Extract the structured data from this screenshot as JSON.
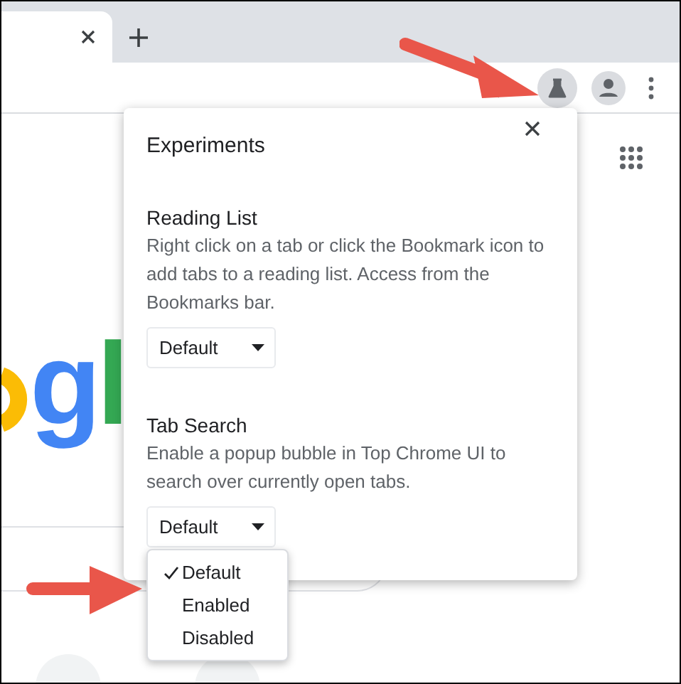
{
  "tab_strip": {
    "tabs": [
      {
        "selected": true
      }
    ]
  },
  "page": {
    "logo_letters": [
      {
        "char": "g",
        "color": "#4285f4"
      },
      {
        "char": "l",
        "color": "#34a853"
      }
    ]
  },
  "experiments": {
    "title": "Experiments",
    "items": [
      {
        "title": "Reading List",
        "description": "Right click on a tab or click the Bookmark icon to add tabs to a reading list. Access from the Bookmarks bar.",
        "select": {
          "value": "Default"
        }
      },
      {
        "title": "Tab Search",
        "description": "Enable a popup bubble in Top Chrome UI to search over currently open tabs.",
        "select": {
          "value": "Default",
          "options": [
            {
              "label": "Default",
              "selected": true
            },
            {
              "label": "Enabled",
              "selected": false
            },
            {
              "label": "Disabled",
              "selected": false
            }
          ]
        }
      }
    ]
  }
}
